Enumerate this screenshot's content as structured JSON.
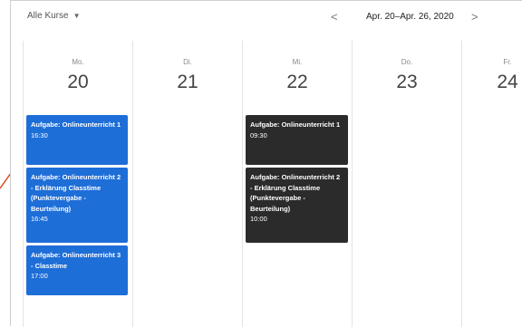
{
  "toolbar": {
    "course_filter": "Alle Kurse",
    "prev_label": "<",
    "date_range": "Apr. 20–Apr. 26, 2020",
    "next_label": ">"
  },
  "days": [
    {
      "name": "Mo.",
      "num": "20"
    },
    {
      "name": "Di.",
      "num": "21"
    },
    {
      "name": "Mi.",
      "num": "22"
    },
    {
      "name": "Do.",
      "num": "23"
    },
    {
      "name": "Fr.",
      "num": "24"
    }
  ],
  "events": {
    "mo": [
      {
        "title": "Aufgabe: Onlineunterricht 1",
        "time": "16:30"
      },
      {
        "title": "Aufgabe: Onlineunterricht 2 - Erklärung Classtime (Punktevergabe - Beurteilung)",
        "time": "16:45"
      },
      {
        "title": "Aufgabe: Onlineunterricht 3 - Classtime",
        "time": "17:00"
      }
    ],
    "mi": [
      {
        "title": "Aufgabe: Onlineunterricht 1",
        "time": "09:30"
      },
      {
        "title": "Aufgabe: Onlineunterricht 2 - Erklärung Classtime (Punktevergabe - Beurteilung)",
        "time": "10:00"
      }
    ]
  },
  "colors": {
    "event_blue": "#1e6ed8",
    "event_dark": "#2b2b2b"
  }
}
